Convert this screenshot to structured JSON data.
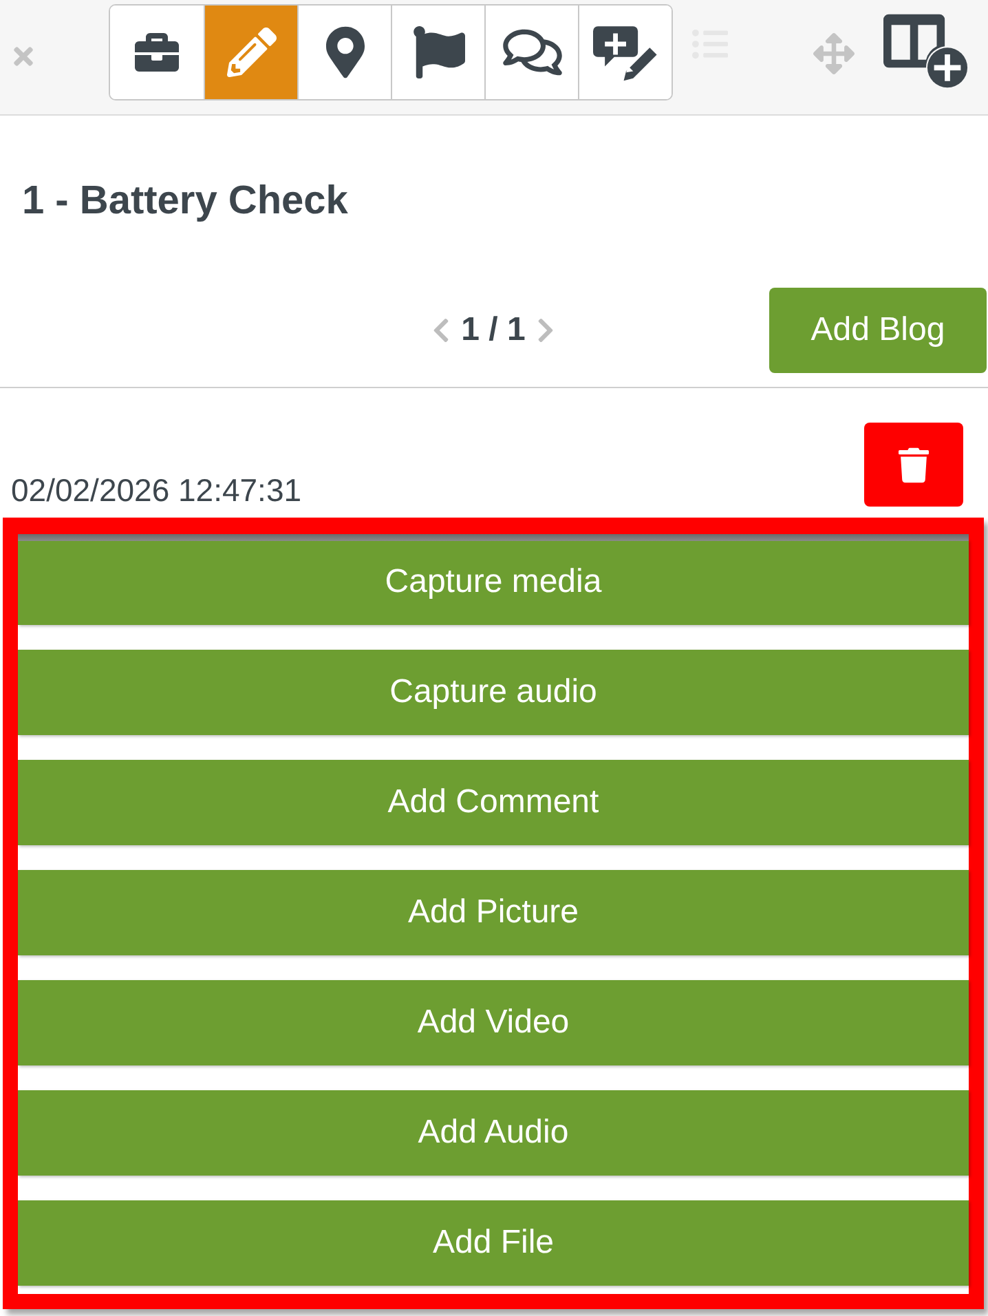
{
  "toolbar": {
    "tools": [
      {
        "selected": false
      },
      {
        "selected": true
      },
      {
        "selected": false
      },
      {
        "selected": false
      },
      {
        "selected": false
      },
      {
        "selected": false
      }
    ],
    "extra_tools": [
      {
        "disabled": true
      },
      {
        "disabled": false
      },
      {
        "disabled": false
      }
    ]
  },
  "title": "1 - Battery Check",
  "pager": {
    "text": "1 / 1",
    "add_button": "Add Blog"
  },
  "entry": {
    "timestamp": "02/02/2026 12:47:31"
  },
  "actions": [
    "Capture media",
    "Capture audio",
    "Add Comment",
    "Add Picture",
    "Add Video",
    "Add Audio",
    "Add File"
  ]
}
